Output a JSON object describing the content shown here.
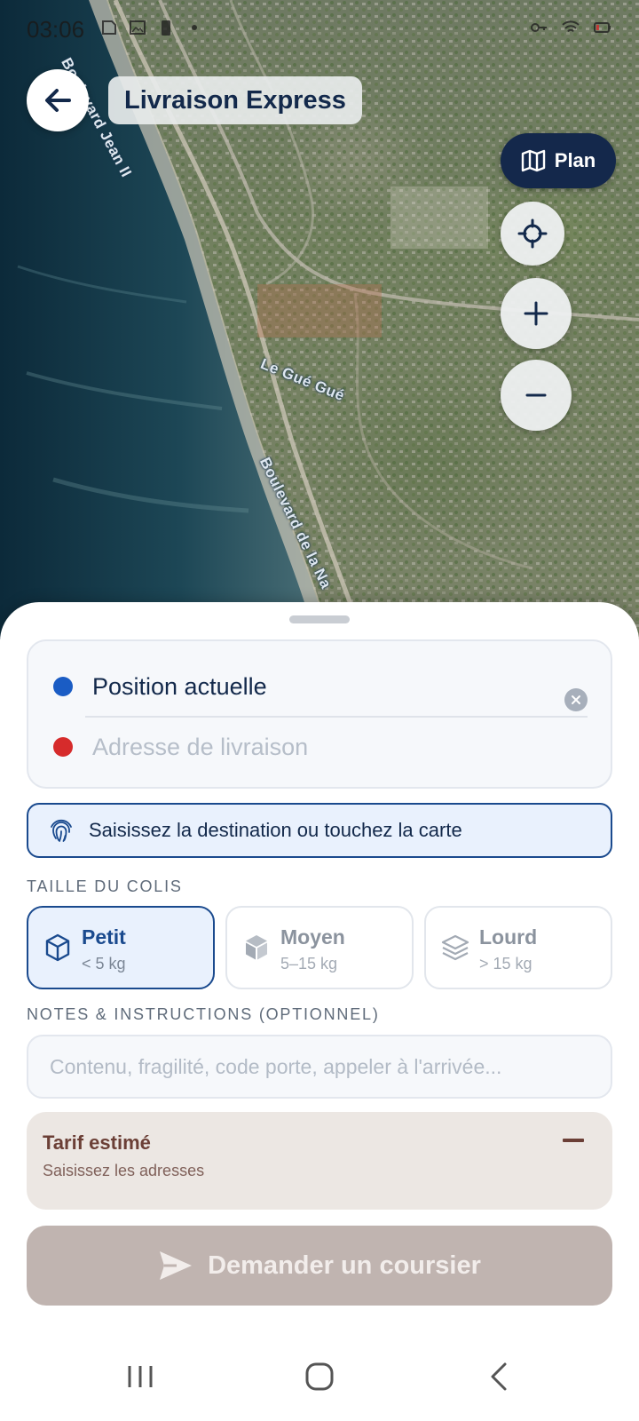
{
  "status_bar": {
    "time": "03:06",
    "left_icons": [
      "sim-icon",
      "image-icon",
      "battery-saver-icon",
      "dot-icon"
    ],
    "right_icons": [
      "key-icon",
      "wifi-icon",
      "battery-low-icon"
    ]
  },
  "header": {
    "title": "Livraison Express",
    "back_icon": "arrow-left-icon"
  },
  "map": {
    "labels": {
      "road_top": "Boulevard Jean II",
      "district": "Le Gué Gué",
      "road_bottom": "Boulevard de la Na"
    },
    "controls": {
      "plan_label": "Plan",
      "plan_icon": "map-icon",
      "locate_icon": "crosshair-icon",
      "zoom_in_icon": "plus-icon",
      "zoom_out_icon": "minus-icon"
    }
  },
  "route": {
    "origin": "Position actuelle",
    "destination_placeholder": "Adresse de livraison",
    "clear_icon": "close-circle-icon"
  },
  "hint": {
    "text": "Saisissez la destination ou touchez la carte",
    "icon": "fingerprint-icon"
  },
  "package_size": {
    "label": "TAILLE DU COLIS",
    "selected": "Petit",
    "options": [
      {
        "name": "Petit",
        "weight": "< 5 kg",
        "icon": "box-outline-icon"
      },
      {
        "name": "Moyen",
        "weight": "5–15 kg",
        "icon": "box-solid-icon"
      },
      {
        "name": "Lourd",
        "weight": "> 15 kg",
        "icon": "layers-icon"
      }
    ]
  },
  "notes": {
    "label": "NOTES & INSTRUCTIONS (OPTIONNEL)",
    "placeholder": "Contenu, fragilité, code porte, appeler à l'arrivée..."
  },
  "fare": {
    "title": "Tarif estimé",
    "subtitle": "Saisissez les adresses",
    "value": "—"
  },
  "cta": {
    "label": "Demander un coursier",
    "icon": "send-icon",
    "enabled": false
  },
  "nav_bar": {
    "items": [
      "recents-icon",
      "home-icon",
      "back-icon"
    ]
  },
  "colors": {
    "primary": "#14284b",
    "accent_blue": "#1a5cc4",
    "origin_dot": "#1a5cc4",
    "destination_dot": "#d62b2b",
    "fare_bg": "#ece7e3",
    "cta_disabled": "#c0b4b0"
  }
}
